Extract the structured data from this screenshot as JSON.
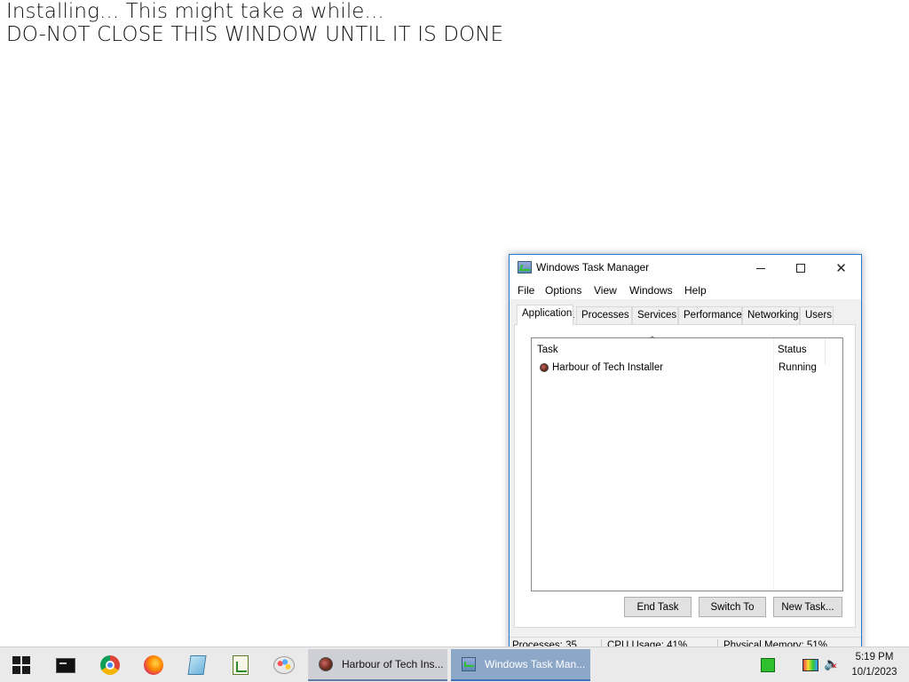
{
  "desktop": {
    "line1": "Installing... This might take a while...",
    "line2": "DO-NOT CLOSE THIS WINDOW UNTIL IT IS DONE"
  },
  "task_manager": {
    "title": "Windows Task Manager",
    "menu": [
      "File",
      "Options",
      "View",
      "Windows",
      "Help"
    ],
    "tabs": [
      "Applications",
      "Processes",
      "Services",
      "Performance",
      "Networking",
      "Users"
    ],
    "active_tab": "Applications",
    "columns": {
      "task": "Task",
      "status": "Status"
    },
    "rows": [
      {
        "task": "Harbour of Tech Installer",
        "status": "Running",
        "icon": "installer-app-icon"
      }
    ],
    "buttons": {
      "end_task": "End Task",
      "switch_to": "Switch To",
      "new_task": "New Task..."
    },
    "status_bar": {
      "processes": "Processes: 35",
      "cpu": "CPU Usage: 41%",
      "memory": "Physical Memory: 51%"
    }
  },
  "taskbar": {
    "pinned": [
      "start-icon",
      "command-prompt-icon",
      "chrome-icon",
      "firefox-icon",
      "notepad-icon",
      "spreadsheet-icon",
      "paint-icon"
    ],
    "tasks": [
      {
        "label": "Harbour of Tech Ins...",
        "icon": "installer-app-icon"
      },
      {
        "label": "Windows Task Man...",
        "icon": "task-manager-icon"
      }
    ],
    "clock": {
      "time": "5:19 PM",
      "date": "10/1/2023"
    }
  }
}
